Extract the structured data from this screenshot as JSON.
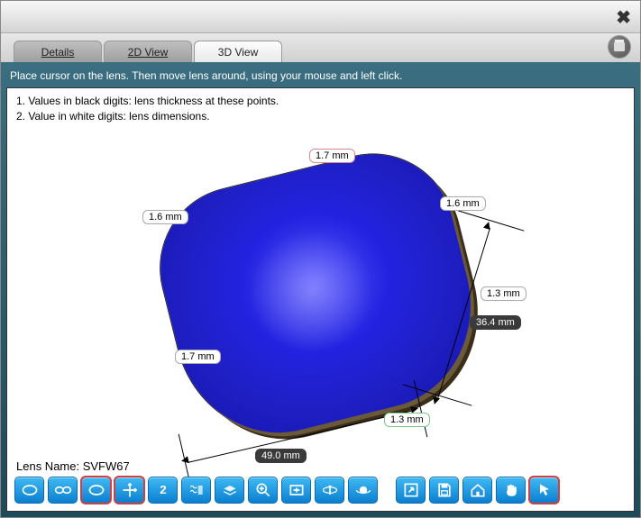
{
  "tabs": {
    "details": "Details",
    "view2d": "2D View",
    "view3d": "3D View"
  },
  "instruction": "Place cursor on the lens. Then move lens around, using your mouse and left click.",
  "legend": {
    "line1": "1. Values in black digits: lens thickness at these points.",
    "line2": "2. Value in white digits: lens dimensions."
  },
  "measurements": {
    "top": "1.7 mm",
    "upper_left": "1.6 mm",
    "upper_right": "1.6 mm",
    "left": "1.7 mm",
    "right": "1.3 mm",
    "bottom_right": "1.3 mm",
    "height": "36.4 mm",
    "width": "49.0 mm"
  },
  "lens_name_label": "Lens Name:",
  "lens_name_value": "SVFW67",
  "toolbar": {
    "single_lens": "single-lens",
    "pair_lens": "pair-lens",
    "frame": "frame-view",
    "axes": "axes",
    "two": "2",
    "waves": "waves",
    "layers": "layers",
    "zoom_in": "zoom-in",
    "fit": "fit",
    "rotate": "rotate",
    "orbit": "orbit",
    "screen": "fullscreen",
    "save": "save",
    "home": "home",
    "pan": "pan-hand",
    "pointer": "pointer"
  }
}
